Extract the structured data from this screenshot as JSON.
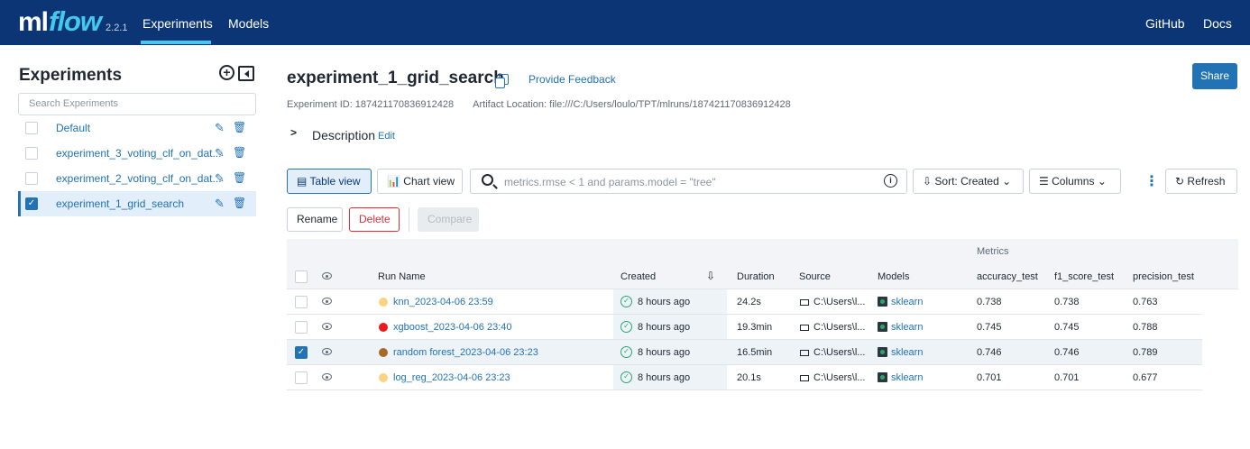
{
  "header": {
    "logo_ml": "ml",
    "logo_flow": "flow",
    "version": "2.2.1",
    "nav": [
      "Experiments",
      "Models"
    ],
    "right_links": [
      "GitHub",
      "Docs"
    ],
    "accent": "#43c9ed",
    "bg": "#0b3574"
  },
  "sidebar": {
    "title": "Experiments",
    "search_placeholder": "Search Experiments",
    "items": [
      {
        "label": "Default",
        "selected": false
      },
      {
        "label": "experiment_3_voting_clf_on_dat...",
        "selected": false
      },
      {
        "label": "experiment_2_voting_clf_on_dat...",
        "selected": false
      },
      {
        "label": "experiment_1_grid_search",
        "selected": true
      }
    ]
  },
  "main": {
    "title": "experiment_1_grid_search",
    "feedback": "Provide Feedback",
    "share": "Share",
    "experiment_id": "Experiment ID: 187421170836912428",
    "artifact_location": "Artifact Location: file:///C:/Users/loulo/TPT/mlruns/187421170836912428",
    "description": "Description",
    "description_edit": "Edit"
  },
  "toolbar": {
    "table_view": "Table view",
    "chart_view": "Chart view",
    "filter_placeholder": "metrics.rmse < 1 and params.model = \"tree\"",
    "sort": "Sort: Created",
    "columns": "Columns",
    "refresh": "Refresh",
    "rename": "Rename",
    "delete": "Delete",
    "compare": "Compare"
  },
  "table": {
    "group_label": "Metrics",
    "columns": [
      "Run Name",
      "Created",
      "Duration",
      "Source",
      "Models",
      "accuracy_test",
      "f1_score_test",
      "precision_test"
    ],
    "rows": [
      {
        "name": "knn_2023-04-06 23:59",
        "color": "#fad481",
        "created": "8 hours ago",
        "duration": "24.2s",
        "source": "C:\\Users\\l...",
        "model": "sklearn",
        "accuracy": "0.738",
        "f1": "0.738",
        "precision": "0.763",
        "checked": false
      },
      {
        "name": "xgboost_2023-04-06 23:40",
        "color": "#e81c1c",
        "created": "8 hours ago",
        "duration": "19.3min",
        "source": "C:\\Users\\l...",
        "model": "sklearn",
        "accuracy": "0.745",
        "f1": "0.745",
        "precision": "0.788",
        "checked": false
      },
      {
        "name": "random forest_2023-04-06 23:23",
        "color": "#a96a25",
        "created": "8 hours ago",
        "duration": "16.5min",
        "source": "C:\\Users\\l...",
        "model": "sklearn",
        "accuracy": "0.746",
        "f1": "0.746",
        "precision": "0.789",
        "checked": true
      },
      {
        "name": "log_reg_2023-04-06 23:23",
        "color": "#fad481",
        "created": "8 hours ago",
        "duration": "20.1s",
        "source": "C:\\Users\\l...",
        "model": "sklearn",
        "accuracy": "0.701",
        "f1": "0.701",
        "precision": "0.677",
        "checked": false
      }
    ]
  }
}
